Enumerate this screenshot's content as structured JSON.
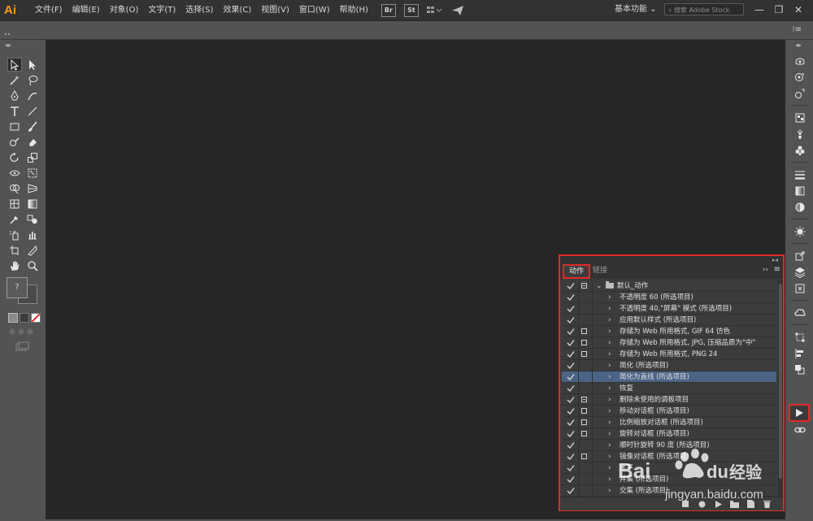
{
  "app": {
    "logo": "Ai"
  },
  "menu": [
    "文件(F)",
    "编辑(E)",
    "对象(O)",
    "文字(T)",
    "选择(S)",
    "效果(C)",
    "视图(V)",
    "窗口(W)",
    "帮助(H)"
  ],
  "menu_icons": {
    "bridge": "Br",
    "stock": "St"
  },
  "workspace": {
    "label": "基本功能 ⌄"
  },
  "search": {
    "placeholder": "搜索 Adobe Stock"
  },
  "window_controls": {
    "minimize": "—",
    "restore": "❐",
    "close": "✕"
  },
  "panel": {
    "tabs": {
      "actions": "动作",
      "links": "链接"
    },
    "more": "››",
    "menu": "≡",
    "rows": [
      {
        "check": true,
        "dialog": "partial",
        "folder": true,
        "expanded": true,
        "label": "默认_动作",
        "selected": false
      },
      {
        "check": true,
        "dialog": "",
        "label": "不透明度 60 (所选项目)",
        "selected": false
      },
      {
        "check": true,
        "dialog": "",
        "label": "不透明度 40,\"屏幕\" 模式 (所选项目)",
        "selected": false
      },
      {
        "check": true,
        "dialog": "",
        "label": "应用默认样式 (所选项目)",
        "selected": false
      },
      {
        "check": true,
        "dialog": "box",
        "label": "存储为 Web 所用格式, GIF 64 仿色",
        "selected": false
      },
      {
        "check": true,
        "dialog": "box",
        "label": "存储为 Web 所用格式, JPG, 压缩品质为\"中\"",
        "selected": false
      },
      {
        "check": true,
        "dialog": "box",
        "label": "存储为 Web 所用格式, PNG 24",
        "selected": false
      },
      {
        "check": true,
        "dialog": "",
        "label": "简化 (所选项目)",
        "selected": false
      },
      {
        "check": true,
        "dialog": "",
        "label": "简化为直线 (所选项目)",
        "selected": true
      },
      {
        "check": true,
        "dialog": "",
        "label": "恢复",
        "selected": false
      },
      {
        "check": true,
        "dialog": "partial",
        "label": "删除未使用的调板项目",
        "selected": false
      },
      {
        "check": true,
        "dialog": "box",
        "label": "移动对话框 (所选项目)",
        "selected": false
      },
      {
        "check": true,
        "dialog": "box",
        "label": "比例缩放对话框 (所选项目)",
        "selected": false
      },
      {
        "check": true,
        "dialog": "box",
        "label": "旋转对话框 (所选项目)",
        "selected": false
      },
      {
        "check": true,
        "dialog": "",
        "label": "顺时针旋转 90 度 (所选项目)",
        "selected": false
      },
      {
        "check": true,
        "dialog": "box",
        "label": "镜像对话框 (所选项目)",
        "selected": false
      },
      {
        "check": true,
        "dialog": "",
        "label": "水平...",
        "selected": false
      },
      {
        "check": true,
        "dialog": "",
        "label": "并集 (所选项目)",
        "selected": false
      },
      {
        "check": true,
        "dialog": "",
        "label": "交集 (所选项目)",
        "selected": false
      }
    ]
  },
  "watermark": {
    "text": "jingyan.baidu.com",
    "brand": "Baidu经验"
  },
  "colors": {
    "accent_red": "#e02a2a",
    "selection": "#4b6485",
    "canvas": "#262626"
  }
}
